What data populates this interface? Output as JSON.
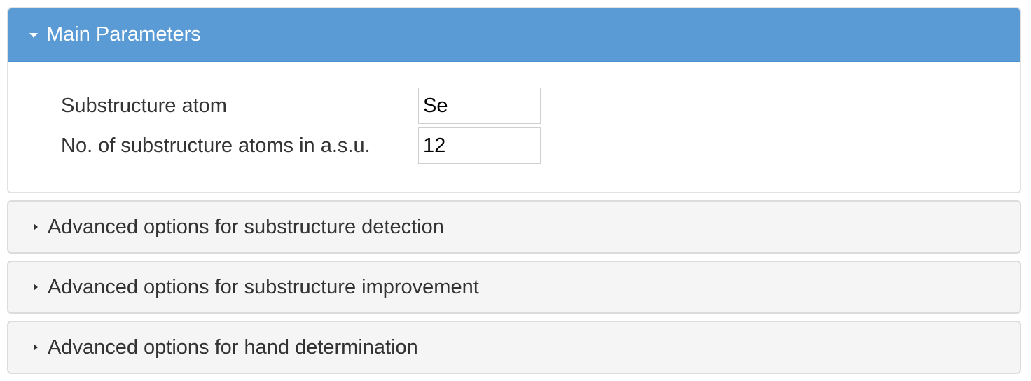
{
  "main_panel": {
    "title": "Main Parameters",
    "icon": "caret-down-icon",
    "fields": [
      {
        "label": "Substructure atom",
        "value": "Se"
      },
      {
        "label": "No. of substructure atoms in a.s.u.",
        "value": "12"
      }
    ]
  },
  "collapsed_panels": [
    {
      "title": "Advanced options for substructure detection",
      "icon": "caret-right-icon"
    },
    {
      "title": "Advanced options for substructure improvement",
      "icon": "caret-right-icon"
    },
    {
      "title": "Advanced options for hand determination",
      "icon": "caret-right-icon"
    }
  ],
  "colors": {
    "header_active": "#5b9bd5",
    "header_collapsed": "#f5f5f5",
    "text": "#333333"
  }
}
